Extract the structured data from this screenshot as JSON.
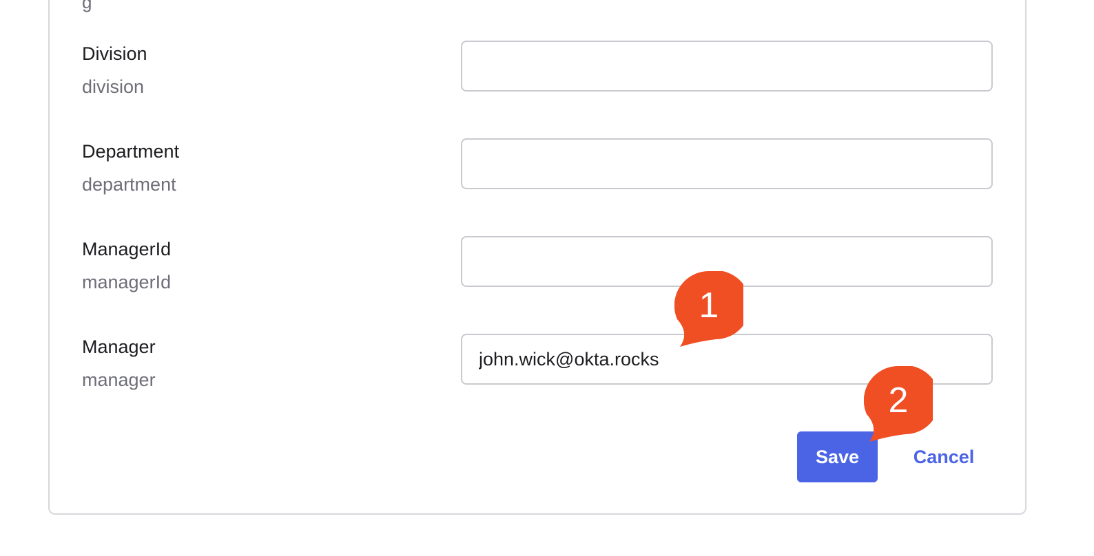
{
  "cut_label_glyph": "g",
  "fields": [
    {
      "label": "Division",
      "attribute": "division",
      "value": ""
    },
    {
      "label": "Department",
      "attribute": "department",
      "value": ""
    },
    {
      "label": "ManagerId",
      "attribute": "managerId",
      "value": ""
    },
    {
      "label": "Manager",
      "attribute": "manager",
      "value": "john.wick@okta.rocks"
    }
  ],
  "actions": {
    "save_label": "Save",
    "cancel_label": "Cancel"
  },
  "callouts": [
    {
      "number": "1",
      "color": "#f04e23"
    },
    {
      "number": "2",
      "color": "#f04e23"
    }
  ],
  "colors": {
    "primary": "#4b64e6",
    "callout": "#f04e23",
    "border": "#c9c9cf"
  }
}
